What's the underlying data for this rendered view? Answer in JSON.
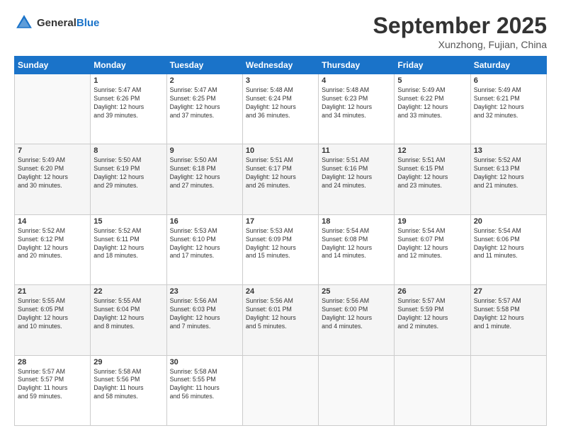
{
  "header": {
    "logo_general": "General",
    "logo_blue": "Blue",
    "month": "September 2025",
    "location": "Xunzhong, Fujian, China"
  },
  "weekdays": [
    "Sunday",
    "Monday",
    "Tuesday",
    "Wednesday",
    "Thursday",
    "Friday",
    "Saturday"
  ],
  "weeks": [
    [
      {
        "day": "",
        "info": ""
      },
      {
        "day": "1",
        "info": "Sunrise: 5:47 AM\nSunset: 6:26 PM\nDaylight: 12 hours\nand 39 minutes."
      },
      {
        "day": "2",
        "info": "Sunrise: 5:47 AM\nSunset: 6:25 PM\nDaylight: 12 hours\nand 37 minutes."
      },
      {
        "day": "3",
        "info": "Sunrise: 5:48 AM\nSunset: 6:24 PM\nDaylight: 12 hours\nand 36 minutes."
      },
      {
        "day": "4",
        "info": "Sunrise: 5:48 AM\nSunset: 6:23 PM\nDaylight: 12 hours\nand 34 minutes."
      },
      {
        "day": "5",
        "info": "Sunrise: 5:49 AM\nSunset: 6:22 PM\nDaylight: 12 hours\nand 33 minutes."
      },
      {
        "day": "6",
        "info": "Sunrise: 5:49 AM\nSunset: 6:21 PM\nDaylight: 12 hours\nand 32 minutes."
      }
    ],
    [
      {
        "day": "7",
        "info": "Sunrise: 5:49 AM\nSunset: 6:20 PM\nDaylight: 12 hours\nand 30 minutes."
      },
      {
        "day": "8",
        "info": "Sunrise: 5:50 AM\nSunset: 6:19 PM\nDaylight: 12 hours\nand 29 minutes."
      },
      {
        "day": "9",
        "info": "Sunrise: 5:50 AM\nSunset: 6:18 PM\nDaylight: 12 hours\nand 27 minutes."
      },
      {
        "day": "10",
        "info": "Sunrise: 5:51 AM\nSunset: 6:17 PM\nDaylight: 12 hours\nand 26 minutes."
      },
      {
        "day": "11",
        "info": "Sunrise: 5:51 AM\nSunset: 6:16 PM\nDaylight: 12 hours\nand 24 minutes."
      },
      {
        "day": "12",
        "info": "Sunrise: 5:51 AM\nSunset: 6:15 PM\nDaylight: 12 hours\nand 23 minutes."
      },
      {
        "day": "13",
        "info": "Sunrise: 5:52 AM\nSunset: 6:13 PM\nDaylight: 12 hours\nand 21 minutes."
      }
    ],
    [
      {
        "day": "14",
        "info": "Sunrise: 5:52 AM\nSunset: 6:12 PM\nDaylight: 12 hours\nand 20 minutes."
      },
      {
        "day": "15",
        "info": "Sunrise: 5:52 AM\nSunset: 6:11 PM\nDaylight: 12 hours\nand 18 minutes."
      },
      {
        "day": "16",
        "info": "Sunrise: 5:53 AM\nSunset: 6:10 PM\nDaylight: 12 hours\nand 17 minutes."
      },
      {
        "day": "17",
        "info": "Sunrise: 5:53 AM\nSunset: 6:09 PM\nDaylight: 12 hours\nand 15 minutes."
      },
      {
        "day": "18",
        "info": "Sunrise: 5:54 AM\nSunset: 6:08 PM\nDaylight: 12 hours\nand 14 minutes."
      },
      {
        "day": "19",
        "info": "Sunrise: 5:54 AM\nSunset: 6:07 PM\nDaylight: 12 hours\nand 12 minutes."
      },
      {
        "day": "20",
        "info": "Sunrise: 5:54 AM\nSunset: 6:06 PM\nDaylight: 12 hours\nand 11 minutes."
      }
    ],
    [
      {
        "day": "21",
        "info": "Sunrise: 5:55 AM\nSunset: 6:05 PM\nDaylight: 12 hours\nand 10 minutes."
      },
      {
        "day": "22",
        "info": "Sunrise: 5:55 AM\nSunset: 6:04 PM\nDaylight: 12 hours\nand 8 minutes."
      },
      {
        "day": "23",
        "info": "Sunrise: 5:56 AM\nSunset: 6:03 PM\nDaylight: 12 hours\nand 7 minutes."
      },
      {
        "day": "24",
        "info": "Sunrise: 5:56 AM\nSunset: 6:01 PM\nDaylight: 12 hours\nand 5 minutes."
      },
      {
        "day": "25",
        "info": "Sunrise: 5:56 AM\nSunset: 6:00 PM\nDaylight: 12 hours\nand 4 minutes."
      },
      {
        "day": "26",
        "info": "Sunrise: 5:57 AM\nSunset: 5:59 PM\nDaylight: 12 hours\nand 2 minutes."
      },
      {
        "day": "27",
        "info": "Sunrise: 5:57 AM\nSunset: 5:58 PM\nDaylight: 12 hours\nand 1 minute."
      }
    ],
    [
      {
        "day": "28",
        "info": "Sunrise: 5:57 AM\nSunset: 5:57 PM\nDaylight: 11 hours\nand 59 minutes."
      },
      {
        "day": "29",
        "info": "Sunrise: 5:58 AM\nSunset: 5:56 PM\nDaylight: 11 hours\nand 58 minutes."
      },
      {
        "day": "30",
        "info": "Sunrise: 5:58 AM\nSunset: 5:55 PM\nDaylight: 11 hours\nand 56 minutes."
      },
      {
        "day": "",
        "info": ""
      },
      {
        "day": "",
        "info": ""
      },
      {
        "day": "",
        "info": ""
      },
      {
        "day": "",
        "info": ""
      }
    ]
  ]
}
